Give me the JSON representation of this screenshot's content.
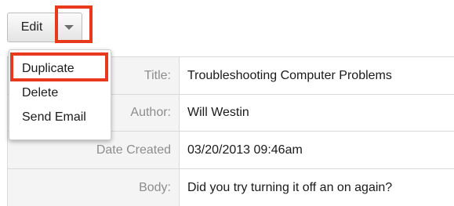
{
  "toolbar": {
    "edit_label": "Edit",
    "caret_icon": "caret-down-icon"
  },
  "menu": {
    "items": [
      {
        "label": "Duplicate"
      },
      {
        "label": "Delete"
      },
      {
        "label": "Send Email"
      }
    ]
  },
  "detail": {
    "rows": [
      {
        "label": "Title:",
        "value": "Troubleshooting Computer Problems"
      },
      {
        "label": "Author:",
        "value": "Will Westin"
      },
      {
        "label": "Date Created",
        "value": "03/20/2013 09:46am"
      },
      {
        "label": "Body:",
        "value": "Did you try turning it off an on again?"
      }
    ]
  },
  "colors": {
    "highlight": "#e8391d",
    "label_bg": "#f4f4f4",
    "label_text": "#8d8d8d",
    "border": "#d9d9d9"
  }
}
